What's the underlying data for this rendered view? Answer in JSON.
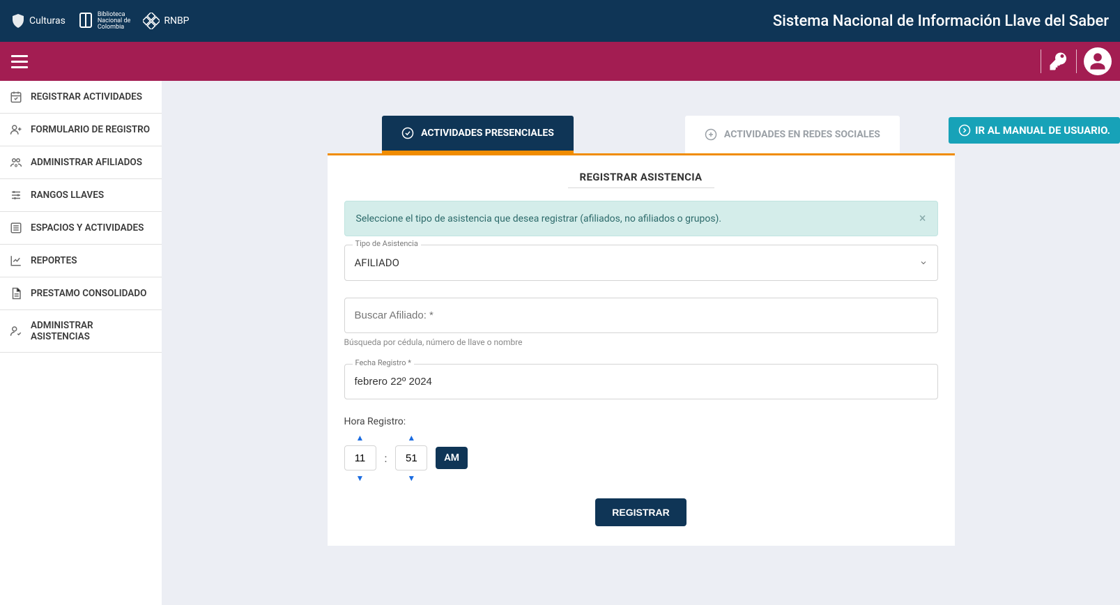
{
  "header": {
    "logo1": "Culturas",
    "logo2_line1": "Biblioteca",
    "logo2_line2": "Nacional de",
    "logo2_line3": "Colombia",
    "logo3": "RNBP",
    "system_title": "Sistema Nacional de Información Llave del Saber"
  },
  "sidebar": {
    "items": [
      {
        "label": "REGISTRAR ACTIVIDADES",
        "icon": "calendar-check-icon"
      },
      {
        "label": "FORMULARIO DE REGISTRO",
        "icon": "user-plus-icon"
      },
      {
        "label": "ADMINISTRAR AFILIADOS",
        "icon": "users-cog-icon"
      },
      {
        "label": "RANGOS LLAVES",
        "icon": "sliders-icon"
      },
      {
        "label": "ESPACIOS Y ACTIVIDADES",
        "icon": "list-icon"
      },
      {
        "label": "REPORTES",
        "icon": "chart-line-icon"
      },
      {
        "label": "PRESTAMO CONSOLIDADO",
        "icon": "file-icon"
      },
      {
        "label": "ADMINISTRAR ASISTENCIAS",
        "icon": "user-check-icon"
      }
    ]
  },
  "manual_button": "IR AL MANUAL DE USUARIO.",
  "tabs": {
    "active": "ACTIVIDADES PRESENCIALES",
    "inactive": "ACTIVIDADES EN REDES SOCIALES"
  },
  "card": {
    "title": "REGISTRAR ASISTENCIA",
    "alert": "Seleccione el tipo de asistencia que desea registrar (afiliados, no afiliados o grupos).",
    "tipo_label": "Tipo de Asistencia",
    "tipo_value": "AFILIADO",
    "buscar_placeholder": "Buscar Afiliado: *",
    "buscar_help": "Búsqueda por cédula, número de llave o nombre",
    "fecha_label": "Fecha Registro *",
    "fecha_value": "febrero 22º 2024",
    "hora_label": "Hora Registro:",
    "hora_h": "11",
    "hora_m": "51",
    "hora_ampm": "AM",
    "submit": "REGISTRAR"
  }
}
